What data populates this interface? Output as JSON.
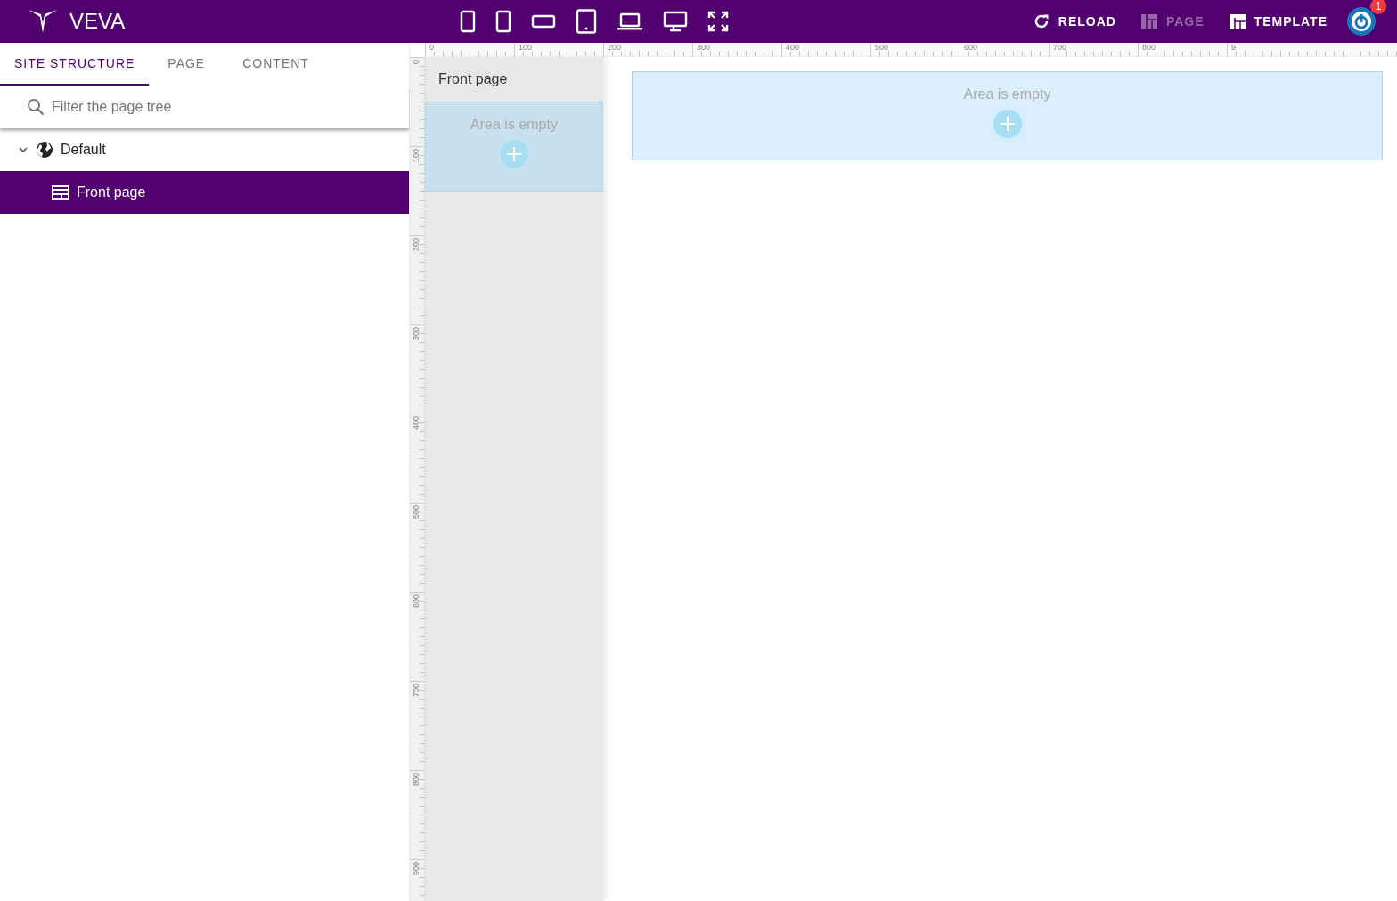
{
  "header": {
    "logo": "VEVA",
    "actions": [
      {
        "kind": "reload",
        "label": "RELOAD",
        "disabled": false
      },
      {
        "kind": "page",
        "label": "PAGE",
        "disabled": true
      },
      {
        "kind": "template",
        "label": "TEMPLATE",
        "disabled": false
      }
    ],
    "user": {
      "badge": "1"
    }
  },
  "tabs": [
    {
      "label": "SITE STRUCTURE",
      "selected": true
    },
    {
      "label": "PAGE",
      "selected": false
    },
    {
      "label": "CONTENT",
      "selected": false
    }
  ],
  "search": {
    "placeholder": "Filter the page tree"
  },
  "tree": [
    {
      "label": "Default",
      "kind": "site",
      "expanded": true,
      "selected": false,
      "children": [
        {
          "label": "Front page",
          "kind": "page",
          "selected": true
        }
      ]
    }
  ],
  "rulers": {
    "horizontal": [
      "0",
      "100",
      "200",
      "300",
      "400",
      "500",
      "600",
      "700",
      "800",
      "9"
    ],
    "vertical": [
      "0",
      "100",
      "200",
      "300",
      "400",
      "500",
      "600",
      "700",
      "800",
      "900"
    ]
  },
  "canvas": {
    "frame_title": "Front page",
    "areas": [
      {
        "text": "Area is empty"
      },
      {
        "text": "Area is empty"
      }
    ]
  }
}
